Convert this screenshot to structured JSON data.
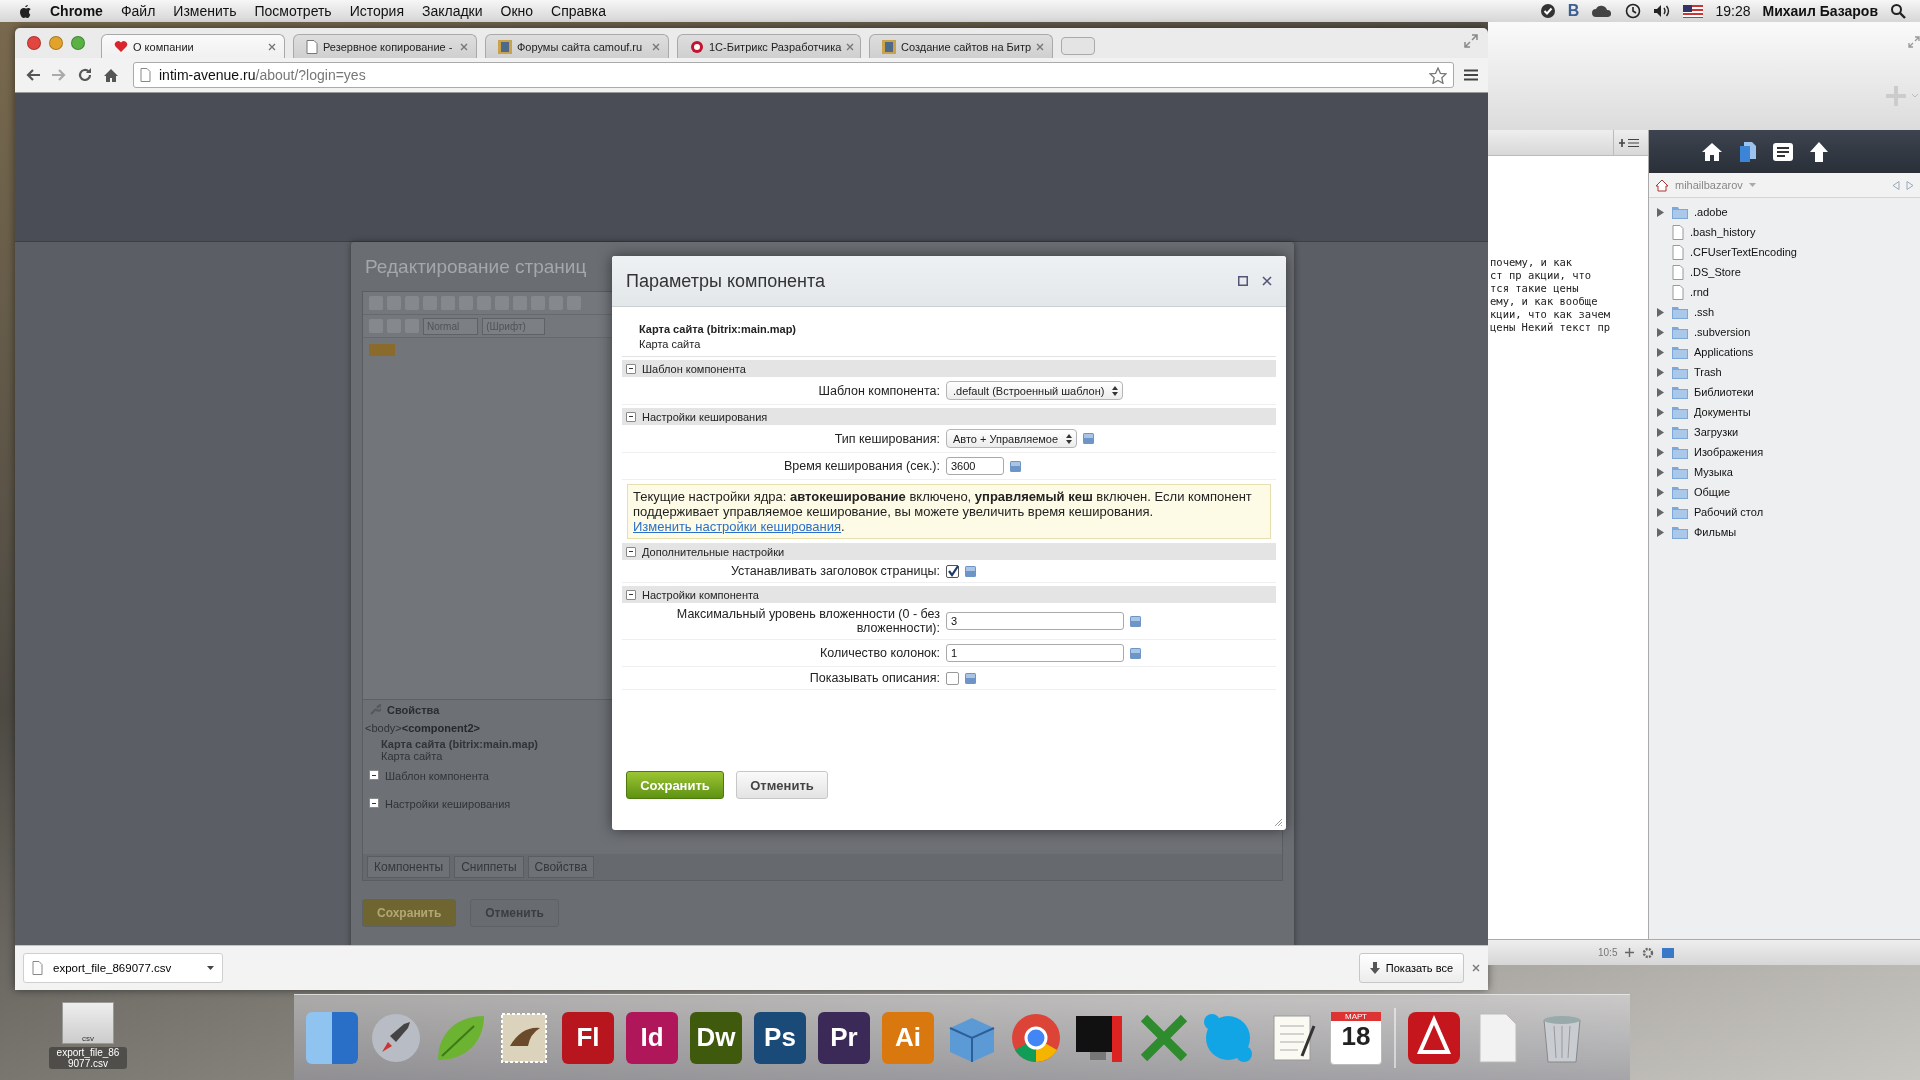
{
  "menubar": {
    "app": "Chrome",
    "items": [
      "Файл",
      "Изменить",
      "Посмотреть",
      "История",
      "Закладки",
      "Окно",
      "Справка"
    ],
    "status_letter": "В",
    "time": "19:28",
    "user": "Михаил Базаров"
  },
  "browser": {
    "tabs": [
      {
        "label": "О компании",
        "selected": true,
        "kind": "heart"
      },
      {
        "label": "Резервное копирование -",
        "selected": false,
        "kind": "page"
      },
      {
        "label": "Форумы сайта camouf.ru",
        "selected": false,
        "kind": "picture"
      },
      {
        "label": "1С-Битрикс Разработчика",
        "selected": false,
        "kind": "ring"
      },
      {
        "label": "Создание сайтов на Битр",
        "selected": false,
        "kind": "picture"
      }
    ],
    "url_host": "intim-avenue.ru",
    "url_path": "/about/?login=yes"
  },
  "editor_window": {
    "title": "Редактирование страниц",
    "style_select": "Normal",
    "font_select": "(Шрифт)",
    "properties": {
      "title": "Свойства",
      "path_tag": "<body>",
      "path_current": "<component2>",
      "component_name": "Карта сайта (bitrix:main.map)",
      "component_desc": "Карта сайта",
      "groups": [
        "Шаблон компонента",
        "Настройки кеширования"
      ]
    },
    "tabs": [
      "Компоненты",
      "Сниппеты",
      "Свойства"
    ],
    "buttons": [
      {
        "label": "Сохранить",
        "kind": "primary"
      },
      {
        "label": "Отменить",
        "kind": "secondary"
      }
    ]
  },
  "dialog": {
    "title": "Параметры компонента",
    "component_name": "Карта сайта (bitrix:main.map)",
    "component_desc": "Карта сайта",
    "groups": [
      {
        "title": "Шаблон компонента",
        "expanded": true,
        "rows": [
          {
            "kind": "select",
            "label": "Шаблон компонента:",
            "value": ".default (Встроенный шаблон)",
            "help": false
          }
        ]
      },
      {
        "title": "Настройки кеширования",
        "expanded": true,
        "rows": [
          {
            "kind": "select",
            "label": "Тип кеширования:",
            "value": "Авто + Управляемое",
            "help": true
          },
          {
            "kind": "input",
            "label": "Время кеширования (сек.):",
            "value": "3600",
            "wide": false,
            "help": true
          },
          {
            "kind": "notice",
            "text": "Текущие настройки ядра: **автокеширование** включено, **управляемый кеш** включен. Если компонент поддерживает управляемое кеширование, вы можете увеличить время кеширования.",
            "link": "Изменить настройки кеширования",
            "tail": "."
          }
        ]
      },
      {
        "title": "Дополнительные настройки",
        "expanded": true,
        "rows": [
          {
            "kind": "checkbox",
            "label": "Устанавливать заголовок страницы:",
            "checked": true,
            "help": true
          }
        ]
      },
      {
        "title": "Настройки компонента",
        "expanded": true,
        "rows": [
          {
            "kind": "input",
            "label": "Максимальный уровень вложенности (0 - без вложенности):",
            "value": "3",
            "wide": true,
            "help": true
          },
          {
            "kind": "input",
            "label": "Количество колонок:",
            "value": "1",
            "wide": true,
            "help": true
          },
          {
            "kind": "checkbox",
            "label": "Показывать описания:",
            "checked": false,
            "help": true
          }
        ]
      }
    ],
    "buttons": [
      {
        "label": "Сохранить",
        "kind": "primary"
      },
      {
        "label": "Отменить",
        "kind": "secondary"
      }
    ]
  },
  "downloads": {
    "file": "export_file_869077.csv",
    "show_all": "Показать все"
  },
  "file_manager": {
    "editor_lines": [
      "почему, и как",
      "ст пр акции, что",
      "тся такие цены",
      "ему, и как вообще",
      "кции, что как зачем",
      "цены Некий текст пр"
    ],
    "path": "mihailbazarov",
    "entries": [
      {
        "name": ".adobe",
        "kind": "folder"
      },
      {
        "name": ".bash_history",
        "kind": "file"
      },
      {
        "name": ".CFUserTextEncoding",
        "kind": "file"
      },
      {
        "name": ".DS_Store",
        "kind": "file"
      },
      {
        "name": ".rnd",
        "kind": "file"
      },
      {
        "name": ".ssh",
        "kind": "folder"
      },
      {
        "name": ".subversion",
        "kind": "folder"
      },
      {
        "name": "Applications",
        "kind": "folder"
      },
      {
        "name": "Trash",
        "kind": "folder"
      },
      {
        "name": "Библиотеки",
        "kind": "folder"
      },
      {
        "name": "Документы",
        "kind": "folder"
      },
      {
        "name": "Загрузки",
        "kind": "folder"
      },
      {
        "name": "Изображения",
        "kind": "folder"
      },
      {
        "name": "Музыка",
        "kind": "folder"
      },
      {
        "name": "Общие",
        "kind": "folder"
      },
      {
        "name": "Рабочий стол",
        "kind": "folder"
      },
      {
        "name": "Фильмы",
        "kind": "folder"
      }
    ],
    "cursor_position": "10:5"
  },
  "dock": {
    "items": [
      {
        "kind": "finder"
      },
      {
        "kind": "rocket"
      },
      {
        "kind": "leaf"
      },
      {
        "kind": "bird"
      },
      {
        "kind": "letter",
        "label": "Fl",
        "color": "#b8161f"
      },
      {
        "kind": "letter",
        "label": "Id",
        "color": "#b0165a"
      },
      {
        "kind": "letter",
        "label": "Dw",
        "color": "#3f5a0c"
      },
      {
        "kind": "letter",
        "label": "Ps",
        "color": "#1a4b78"
      },
      {
        "kind": "letter",
        "label": "Pr",
        "color": "#3b2a58"
      },
      {
        "kind": "letter",
        "label": "Ai",
        "color": "#d9780f"
      },
      {
        "kind": "box"
      },
      {
        "kind": "globe"
      },
      {
        "kind": "monitor"
      },
      {
        "kind": "cross"
      },
      {
        "kind": "bubble"
      },
      {
        "kind": "notepad"
      },
      {
        "kind": "calendar",
        "month": "МАРТ",
        "day": "18"
      },
      {
        "kind": "separator"
      },
      {
        "kind": "swirl"
      },
      {
        "kind": "blank"
      },
      {
        "kind": "trash"
      }
    ]
  },
  "desktop": {
    "file_type": "csv",
    "file_name": "export_file_86 9077.csv"
  }
}
